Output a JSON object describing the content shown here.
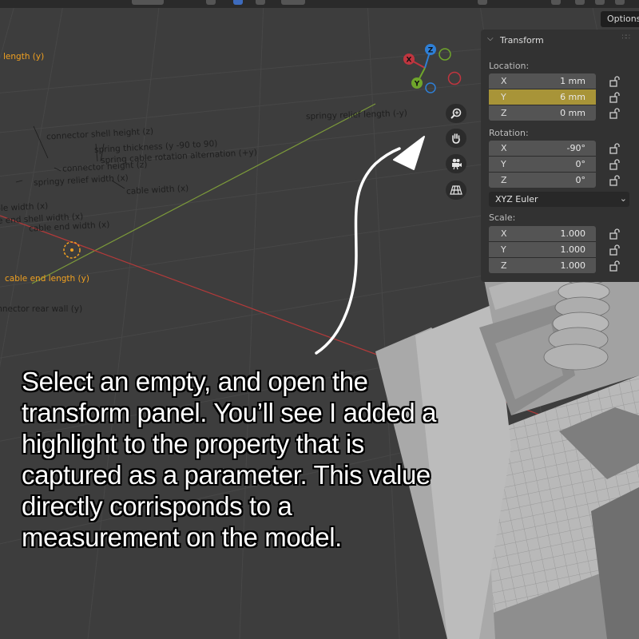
{
  "toolbar": {
    "options_label": "Options"
  },
  "gizmo": {
    "x": "X",
    "y": "Y",
    "z": "Z"
  },
  "viewport_labels": [
    "length (y)",
    "springy relief length (-y)",
    "connector shell height (z)",
    "spring thickness (y -90 to 90)",
    "spring cable rotation alternation (+y)",
    "connector height (z)",
    "springy relief width (x)",
    "cable width (x)",
    "cable width (x)",
    "le end shell width (x)",
    "cable end width (x)",
    "cable end length (y)",
    "connector rear wall (y)"
  ],
  "transform": {
    "title": "Transform",
    "location_label": "Location:",
    "location": [
      {
        "axis": "X",
        "value": "1 mm"
      },
      {
        "axis": "Y",
        "value": "6 mm",
        "highlighted": true
      },
      {
        "axis": "Z",
        "value": "0 mm"
      }
    ],
    "rotation_label": "Rotation:",
    "rotation": [
      {
        "axis": "X",
        "value": "-90°"
      },
      {
        "axis": "Y",
        "value": "0°"
      },
      {
        "axis": "Z",
        "value": "0°"
      }
    ],
    "rotation_mode": "XYZ Euler",
    "scale_label": "Scale:",
    "scale": [
      {
        "axis": "X",
        "value": "1.000"
      },
      {
        "axis": "Y",
        "value": "1.000"
      },
      {
        "axis": "Z",
        "value": "1.000"
      }
    ]
  },
  "caption": {
    "lines": [
      "Select an empty, and open the",
      "transform panel. You’ll see I added a",
      "highlight to the property that is",
      "captured as a parameter. This value",
      "directly corrisponds to a",
      "measurement on the model."
    ]
  },
  "colors": {
    "viewport_bg": "#3d3d3d",
    "panel_bg": "#323232",
    "field_bg": "#545454",
    "highlight": "#a89438",
    "selected_label": "#f0a020",
    "x_axis": "#c0353f",
    "y_axis": "#6fa52b",
    "z_axis": "#2e7fd6"
  }
}
